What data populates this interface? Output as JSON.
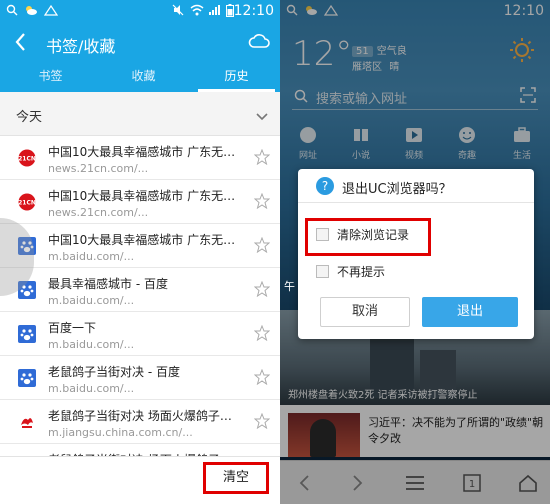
{
  "colors": {
    "brand_blue": "#1aa6e4",
    "highlight_red": "#e00000",
    "dialog_exit_blue": "#38a6e8"
  },
  "left": {
    "status": {
      "time": "12:10"
    },
    "header": {
      "title": "书签/收藏"
    },
    "tabs": [
      {
        "label": "书签",
        "active": false
      },
      {
        "label": "收藏",
        "active": false
      },
      {
        "label": "历史",
        "active": true
      }
    ],
    "section": {
      "label": "今天"
    },
    "history": [
      {
        "icon": "21cn-icon",
        "title": "中国10大最具幸福感城市 广东无城...",
        "url": "news.21cn.com/..."
      },
      {
        "icon": "21cn-icon",
        "title": "中国10大最具幸福感城市 广东无城...",
        "url": "news.21cn.com/..."
      },
      {
        "icon": "baidu-icon",
        "title": "中国10大最具幸福感城市 广东无城...",
        "url": "m.baidu.com/..."
      },
      {
        "icon": "baidu-icon",
        "title": "最具幸福感城市 - 百度",
        "url": "m.baidu.com/..."
      },
      {
        "icon": "baidu-icon",
        "title": "百度一下",
        "url": "m.baidu.com/..."
      },
      {
        "icon": "baidu-icon",
        "title": "老鼠鸽子当街对决 - 百度",
        "url": "m.baidu.com/..."
      },
      {
        "icon": "jiangsu-icon",
        "title": "老鼠鸽子当街对决 场面火爆鸽子竟被...",
        "url": "m.jiangsu.china.com.cn/..."
      },
      {
        "icon": "jiangsu-icon",
        "title": "老鼠鸽子当街对决 场面火爆鸽子竟被...",
        "url": ""
      }
    ],
    "clear_label": "清空"
  },
  "right": {
    "status": {
      "time": "12:10"
    },
    "weather": {
      "temp": "12°",
      "aqi_value": "51",
      "aqi_label": "空气良",
      "location": "雁塔区",
      "condition": "晴"
    },
    "search": {
      "placeholder": "搜索或输入网址"
    },
    "nav": [
      {
        "label": "网址"
      },
      {
        "label": "小说"
      },
      {
        "label": "视频"
      },
      {
        "label": "奇趣"
      },
      {
        "label": "生活"
      }
    ],
    "side_peek": "午",
    "news1_caption": "郑州楼盘着火致2死 记者采访被打警察停止",
    "news2_title": "习近平：决不能为了所谓的\"政绩\"朝令夕改",
    "dialog": {
      "title": "退出UC浏览器吗？",
      "option_clear": "清除浏览记录",
      "option_nomore": "不再提示",
      "cancel": "取消",
      "exit": "退出"
    },
    "tab_count": "1"
  }
}
